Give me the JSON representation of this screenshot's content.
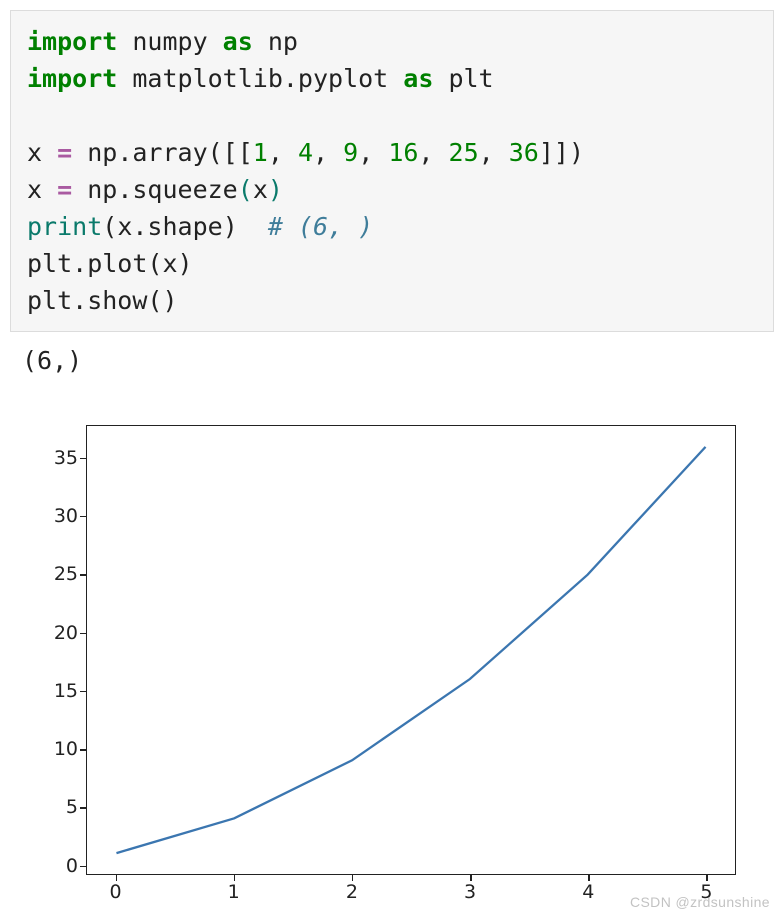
{
  "code": {
    "line1": {
      "kw1": "import",
      "mod1": " numpy ",
      "kw2": "as",
      "alias1": " np"
    },
    "line2": {
      "kw1": "import",
      "mod1": " matplotlib.pyplot ",
      "kw2": "as",
      "alias1": " plt"
    },
    "line3": "",
    "line4": {
      "pre": "x ",
      "op": "=",
      "mid": " np.array([[",
      "n1": "1",
      "c1": ", ",
      "n2": "4",
      "c2": ", ",
      "n3": "9",
      "c3": ", ",
      "n4": "16",
      "c4": ", ",
      "n5": "25",
      "c5": ", ",
      "n6": "36",
      "end": "]])"
    },
    "line5": {
      "pre": "x ",
      "op": "=",
      "mid": " np.squeeze",
      "p1": "(",
      "arg": "x",
      "p2": ")"
    },
    "line6": {
      "fn": "print",
      "p1": "(",
      "arg": "x.shape",
      "p2": ")",
      "pad": "  ",
      "cm": "# (6, )"
    },
    "line7": {
      "pre": "plt.plot(x)"
    },
    "line8": {
      "pre": "plt.show()"
    }
  },
  "output": "(6,)",
  "chart_data": {
    "type": "line",
    "x": [
      0,
      1,
      2,
      3,
      4,
      5
    ],
    "values": [
      1,
      4,
      9,
      16,
      25,
      36
    ],
    "xlabel": "",
    "ylabel": "",
    "title": "",
    "xlim": [
      -0.25,
      5.25
    ],
    "ylim": [
      -0.8,
      37.8
    ],
    "xticks": [
      0,
      1,
      2,
      3,
      4,
      5
    ],
    "yticks": [
      0,
      5,
      10,
      15,
      20,
      25,
      30,
      35
    ],
    "line_color": "#3b76b0"
  },
  "watermark": "CSDN @zrdsunshine"
}
